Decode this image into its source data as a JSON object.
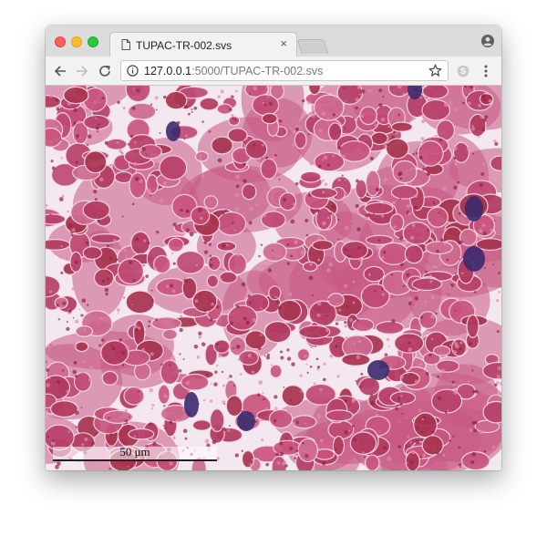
{
  "browser": {
    "tab": {
      "title": "TUPAC-TR-002.svs",
      "close_glyph": "×"
    },
    "address_bar": {
      "host": "127.0.0.1",
      "path": ":5000/TUPAC-TR-002.svs"
    },
    "icons": {
      "traffic_lights": [
        "close-window-icon",
        "minimize-window-icon",
        "maximize-window-icon"
      ],
      "tab": "document-icon",
      "profile": "account-circle-icon",
      "back": "arrow-left-icon",
      "forward": "arrow-right-icon",
      "reload": "reload-icon",
      "site_info": "info-icon",
      "bookmark": "star-icon",
      "extension": "skype-icon",
      "menu": "kebab-menu-icon"
    }
  },
  "viewer": {
    "content": "histology slide tile (H&E stained tissue)",
    "scale_bar": {
      "label": "50 μm"
    }
  },
  "colors": {
    "tissue_base": "#c85a85",
    "tissue_dark": "#a8344f",
    "nucleus": "#3b2a6e",
    "stroma_light": "#f3e7f0",
    "traffic_close": "#fc5f57",
    "traffic_min": "#fdbc2e",
    "traffic_max": "#29c840"
  }
}
